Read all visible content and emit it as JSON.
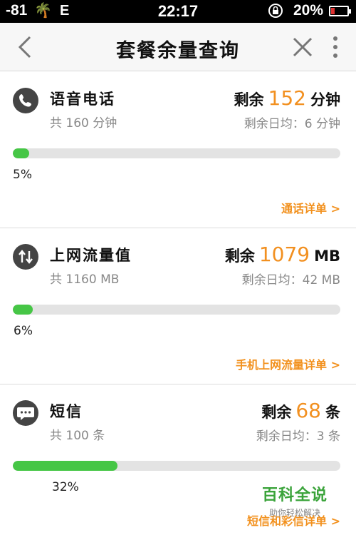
{
  "status_bar": {
    "signal": "-81",
    "carrier_icon": "palm-tree-icon",
    "network": "E",
    "time": "22:17",
    "rotation_lock_icon": "rotation-lock-icon",
    "battery_percent": "20%",
    "battery_level": 0.2
  },
  "header": {
    "title": "套餐余量查询",
    "back_icon": "chevron-left-icon",
    "close_icon": "close-icon",
    "more_icon": "more-vertical-icon"
  },
  "colors": {
    "accent_orange": "#f29020",
    "progress_green": "#46c646",
    "icon_bg": "#444444"
  },
  "cards": [
    {
      "icon": "phone-icon",
      "name": "语音电话",
      "total": "共 160 分钟",
      "remain_prefix": "剩余",
      "remain_value": "152",
      "remain_unit": "分钟",
      "daily": "剩余日均：6 分钟",
      "progress": 0.05,
      "progress_label": "5%",
      "link": "通话详单 >"
    },
    {
      "icon": "data-transfer-icon",
      "name": "上网流量值",
      "total": "共 1160 MB",
      "remain_prefix": "剩余",
      "remain_value": "1079",
      "remain_unit": "MB",
      "daily": "剩余日均：42 MB",
      "progress": 0.06,
      "progress_label": "6%",
      "link": "手机上网流量详单 >"
    },
    {
      "icon": "message-icon",
      "name": "短信",
      "total": "共 100 条",
      "remain_prefix": "剩余",
      "remain_value": "68",
      "remain_unit": "条",
      "daily": "剩余日均：3 条",
      "progress": 0.32,
      "progress_label": "32%",
      "link": "短信和彩信详单 >"
    }
  ],
  "watermark": {
    "line1": "百科全说",
    "line2": "助你轻松解决"
  }
}
